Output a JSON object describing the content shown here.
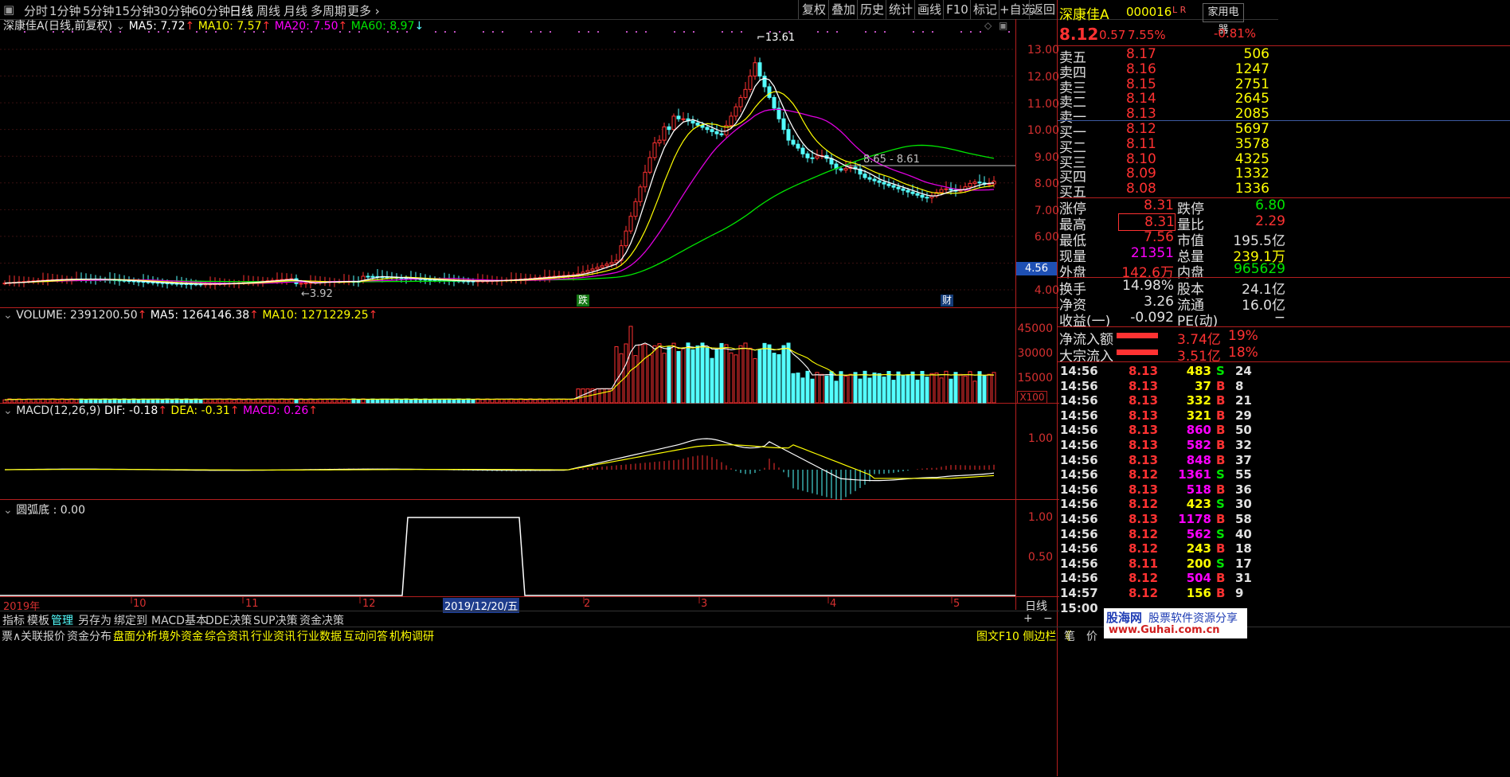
{
  "toolbar": {
    "periods": [
      "分时",
      "1分钟",
      "5分钟",
      "15分钟",
      "30分钟",
      "60分钟",
      "日线",
      "周线",
      "月线",
      "多周期",
      "更多"
    ],
    "active_period": "日线",
    "right_buttons": [
      "复权",
      "叠加",
      "历史",
      "统计",
      "画线",
      "F10",
      "标记",
      "+自选",
      "返回"
    ]
  },
  "main_legend": {
    "name": "深康佳A",
    "mode": "(日线,前复权)",
    "ma5": "MA5: 7.72",
    "ma10": "MA10: 7.57",
    "ma20": "MA20: 7.50",
    "ma60": "MA60: 8.97"
  },
  "main_annotations": {
    "high": "13.61",
    "low": "3.92",
    "level": "8.65 - 8.61",
    "current_price_tag": "4.56",
    "marker_fall": "跌",
    "marker_fin": "财"
  },
  "main_axis": [
    "13.00",
    "12.00",
    "11.00",
    "10.00",
    "9.00",
    "8.00",
    "7.00",
    "6.00",
    "5.00",
    "4.00"
  ],
  "volume_legend": {
    "label": "VOLUME: 2391200.50",
    "ma5": "MA5: 1264146.38",
    "ma10": "MA10: 1271229.25"
  },
  "volume_axis": [
    "45000",
    "30000",
    "15000"
  ],
  "volume_unit": "X100",
  "macd_legend": {
    "label": "MACD(12,26,9)",
    "dif": "DIF: -0.18",
    "dea": "DEA: -0.31",
    "macd": "MACD: 0.26"
  },
  "macd_axis": [
    "1.00"
  ],
  "arc_legend": {
    "label": "圆弧底 : 0.00"
  },
  "arc_axis": [
    "1.00",
    "0.50"
  ],
  "date_axis": {
    "labels": [
      "2019年",
      "10",
      "11",
      "12",
      "2019/12/20/五",
      "2",
      "3",
      "4",
      "5"
    ],
    "right_label": "日线"
  },
  "bottom_tabs": [
    "指标",
    "模板",
    "管理",
    "另存为",
    "绑定到",
    "MACD基本",
    "DDE决策",
    "SUP决策",
    "资金决策"
  ],
  "bottom_tab_active": "管理",
  "bottom_links": [
    "关联报价",
    "资金分布",
    "盘面分析",
    "境外资金",
    "综合资讯",
    "行业资讯",
    "行业数据",
    "互动问答",
    "机构调研"
  ],
  "bottom_left_glyph": "票∧",
  "bottom_right": {
    "text": "图文F10 侧边栏 《",
    "plus": "+",
    "minus": "−"
  },
  "quote": {
    "name": "深康佳A",
    "code": "000016",
    "flags": "L R",
    "sector": "家用电器",
    "sector_change": "-0.81%",
    "price": "8.12",
    "change": "0.57",
    "change_pct": "7.55%",
    "sell": [
      {
        "label": "卖五",
        "price": "8.17",
        "vol": "506"
      },
      {
        "label": "卖四",
        "price": "8.16",
        "vol": "1247"
      },
      {
        "label": "卖三",
        "price": "8.15",
        "vol": "2751"
      },
      {
        "label": "卖二",
        "price": "8.14",
        "vol": "2645"
      },
      {
        "label": "卖一",
        "price": "8.13",
        "vol": "2085"
      }
    ],
    "buy": [
      {
        "label": "买一",
        "price": "8.12",
        "vol": "5697"
      },
      {
        "label": "买二",
        "price": "8.11",
        "vol": "3578"
      },
      {
        "label": "买三",
        "price": "8.10",
        "vol": "4325"
      },
      {
        "label": "买四",
        "price": "8.09",
        "vol": "1332"
      },
      {
        "label": "买五",
        "price": "8.08",
        "vol": "1336"
      }
    ],
    "stats": [
      {
        "l1": "涨停",
        "v1": "8.31",
        "l2": "跌停",
        "v2": "6.80"
      },
      {
        "l1": "最高",
        "v1": "8.31",
        "l2": "量比",
        "v2": "2.29"
      },
      {
        "l1": "最低",
        "v1": "7.56",
        "l2": "市值",
        "v2": "195.5亿"
      },
      {
        "l1": "现量",
        "v1": "21351",
        "l2": "总量",
        "v2": "239.1万"
      },
      {
        "l1": "外盘",
        "v1": "142.6万",
        "l2": "内盘",
        "v2": "965629"
      }
    ],
    "stats2": [
      {
        "l1": "换手",
        "v1": "14.98%",
        "l2": "股本",
        "v2": "24.1亿"
      },
      {
        "l1": "净资",
        "v1": "3.26",
        "l2": "流通",
        "v2": "16.0亿"
      },
      {
        "l1": "收益(一)",
        "v1": "-0.092",
        "l2": "PE(动)",
        "v2": "−"
      }
    ],
    "flows": [
      {
        "label": "净流入额",
        "value": "3.74亿",
        "pct": "19%"
      },
      {
        "label": "大宗流入",
        "value": "3.51亿",
        "pct": "18%"
      }
    ],
    "ticks": [
      {
        "t": "14:56",
        "p": "8.13",
        "v": "483",
        "bs": "S",
        "n": "24"
      },
      {
        "t": "14:56",
        "p": "8.13",
        "v": "37",
        "bs": "B",
        "n": "8"
      },
      {
        "t": "14:56",
        "p": "8.13",
        "v": "332",
        "bs": "B",
        "n": "21"
      },
      {
        "t": "14:56",
        "p": "8.13",
        "v": "321",
        "bs": "B",
        "n": "29"
      },
      {
        "t": "14:56",
        "p": "8.13",
        "v": "860",
        "bs": "B",
        "n": "50"
      },
      {
        "t": "14:56",
        "p": "8.13",
        "v": "582",
        "bs": "B",
        "n": "32"
      },
      {
        "t": "14:56",
        "p": "8.13",
        "v": "848",
        "bs": "B",
        "n": "37"
      },
      {
        "t": "14:56",
        "p": "8.12",
        "v": "1361",
        "bs": "S",
        "n": "55"
      },
      {
        "t": "14:56",
        "p": "8.13",
        "v": "518",
        "bs": "B",
        "n": "36"
      },
      {
        "t": "14:56",
        "p": "8.12",
        "v": "423",
        "bs": "S",
        "n": "30"
      },
      {
        "t": "14:56",
        "p": "8.13",
        "v": "1178",
        "bs": "B",
        "n": "58"
      },
      {
        "t": "14:56",
        "p": "8.12",
        "v": "562",
        "bs": "S",
        "n": "40"
      },
      {
        "t": "14:56",
        "p": "8.12",
        "v": "243",
        "bs": "B",
        "n": "18"
      },
      {
        "t": "14:56",
        "p": "8.11",
        "v": "200",
        "bs": "S",
        "n": "17"
      },
      {
        "t": "14:56",
        "p": "8.12",
        "v": "504",
        "bs": "B",
        "n": "31"
      },
      {
        "t": "14:57",
        "p": "8.12",
        "v": "156",
        "bs": "B",
        "n": "9"
      },
      {
        "t": "15:00",
        "p": "",
        "v": "",
        "bs": "",
        "n": ""
      }
    ],
    "bottom_tabs": [
      "笔",
      "价"
    ]
  },
  "watermark": {
    "line1": "股海网",
    "line2": "股票软件资源分享",
    "url": "www.Guhai.com.cn"
  },
  "colors": {
    "up": "#ff3232",
    "down": "#54ffff",
    "ma5": "#ffffff",
    "ma10": "#ffff00",
    "ma20": "#ff00ff",
    "ma60": "#00e600",
    "axis": "#c81e1e"
  }
}
